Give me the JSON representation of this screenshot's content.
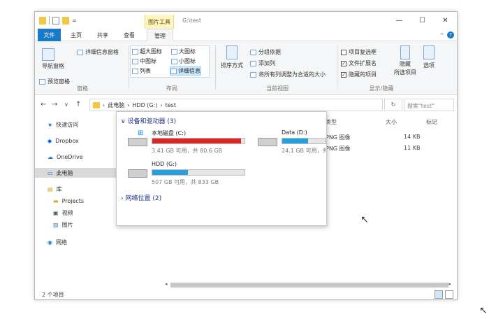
{
  "titlebar": {
    "context_tab": "图片工具",
    "title": "G:\\test",
    "qat_sep": "=",
    "ribbon_toggle": "^",
    "help": "?",
    "minimize": "—",
    "maximize": "☐",
    "close": "✕"
  },
  "tabs": [
    "文件",
    "主页",
    "共享",
    "查看",
    "管理"
  ],
  "ribbon": {
    "panes": {
      "nav_pane": "导航窗格",
      "preview": "预览窗格",
      "details": "详细信息窗格",
      "label": "窗格"
    },
    "layout": {
      "items": [
        "超大图标",
        "大图标",
        "中图标",
        "小图标",
        "列表",
        "详细信息"
      ],
      "label": "布局"
    },
    "current_view": {
      "sort": "排序方式",
      "group_by": "分组依据",
      "add_column": "添加列",
      "fit_columns": "将所有列调整为合适的大小",
      "label": "当前视图"
    },
    "show_hide": {
      "item_checkbox": "项目复选框",
      "file_ext": "文件扩展名",
      "hidden_items": "隐藏的项目",
      "hide_selected": "隐藏",
      "hide_selected2": "所选项目",
      "options": "选项",
      "label": "显示/隐藏"
    }
  },
  "address": {
    "back": "←",
    "forward": "→",
    "dropdown": "∨",
    "up": "↑",
    "crumbs": [
      "此电脑",
      "HDD (G:)",
      "test"
    ],
    "crumb_sep": "›",
    "refresh": "↻",
    "search_placeholder": "搜索\"test\""
  },
  "nav": {
    "items": [
      {
        "label": "快速访问",
        "icon": "star-icon"
      },
      {
        "label": "Dropbox",
        "icon": "dropbox-icon"
      },
      {
        "label": "OneDrive",
        "icon": "onedrive-icon"
      },
      {
        "label": "此电脑",
        "icon": "computer-icon"
      },
      {
        "label": "库",
        "icon": "library-icon"
      },
      {
        "label": "Projects",
        "icon": "folder-icon"
      },
      {
        "label": "视频",
        "icon": "video-icon"
      },
      {
        "label": "图片",
        "icon": "pictures-icon"
      },
      {
        "label": "网络",
        "icon": "network-icon"
      }
    ]
  },
  "columns": {
    "type": "类型",
    "size": "大小",
    "tags": "标记"
  },
  "background_rows": [
    {
      "type": "PNG 图像",
      "size": "14 KB"
    },
    {
      "type": "PNG 图像",
      "size": "11 KB"
    }
  ],
  "status": {
    "count": "2 个项目"
  },
  "popup": {
    "devices_title": "设备和驱动器 (3)",
    "network_title": "网络位置 (2)",
    "chevron_open": "∨",
    "chevron_closed": "›",
    "drives": [
      {
        "name": "本地磁盘 (C:)",
        "info": "3.41 GB 可用，共 80.6 GB",
        "used": 0.96,
        "color": "#da2626"
      },
      {
        "name": "Data (D:)",
        "info": "24.1 GB 可用，共 ...",
        "used": 0.6,
        "color": "#26a0da"
      },
      {
        "name": "HDD (G:)",
        "info": "507 GB 可用，共 833 GB",
        "used": 0.39,
        "color": "#26a0da"
      }
    ]
  }
}
